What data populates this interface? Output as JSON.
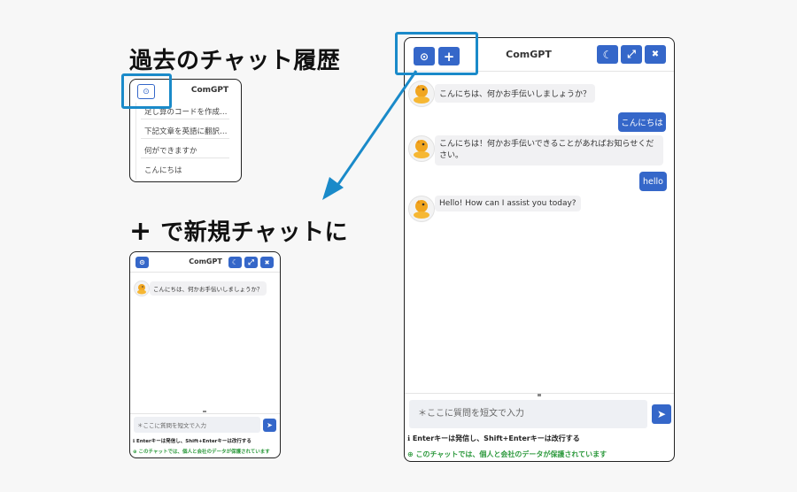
{
  "headings": {
    "history": "過去のチャット履歴",
    "new_chat_plus": "+",
    "new_chat": "で新規チャットに"
  },
  "app": {
    "title": "ComGPT",
    "history_icon": "⊙",
    "plus_icon": "+",
    "moon_icon": "☾",
    "expand_icon": "⤢",
    "close_icon": "✖",
    "send_icon": "➤"
  },
  "history_panel": {
    "items": [
      "足し算のコードを作成…",
      "下記文章を英語に翻訳…",
      "何ができますか",
      "こんにちは"
    ]
  },
  "conversation": {
    "bot_1": "こんにちは、何かお手伝いしましょうか？",
    "user_1": "こんにちは",
    "bot_2": "こんにちは！何かお手伝いできることがあればお知らせください。",
    "user_2": "hello",
    "bot_3": "Hello! How can I assist you today?"
  },
  "input": {
    "placeholder": "＊ここに質問を短文で入力"
  },
  "notes": {
    "enter_hint": "ℹ Enterキーは発信し、Shift+Enterキーは改行する",
    "privacy": "⊕ このチャットでは、個人と会社のデータが保護されています"
  },
  "colors": {
    "accent": "#3567c9",
    "highlight": "#1a8ac9",
    "privacy_text": "#2e9a3e"
  }
}
